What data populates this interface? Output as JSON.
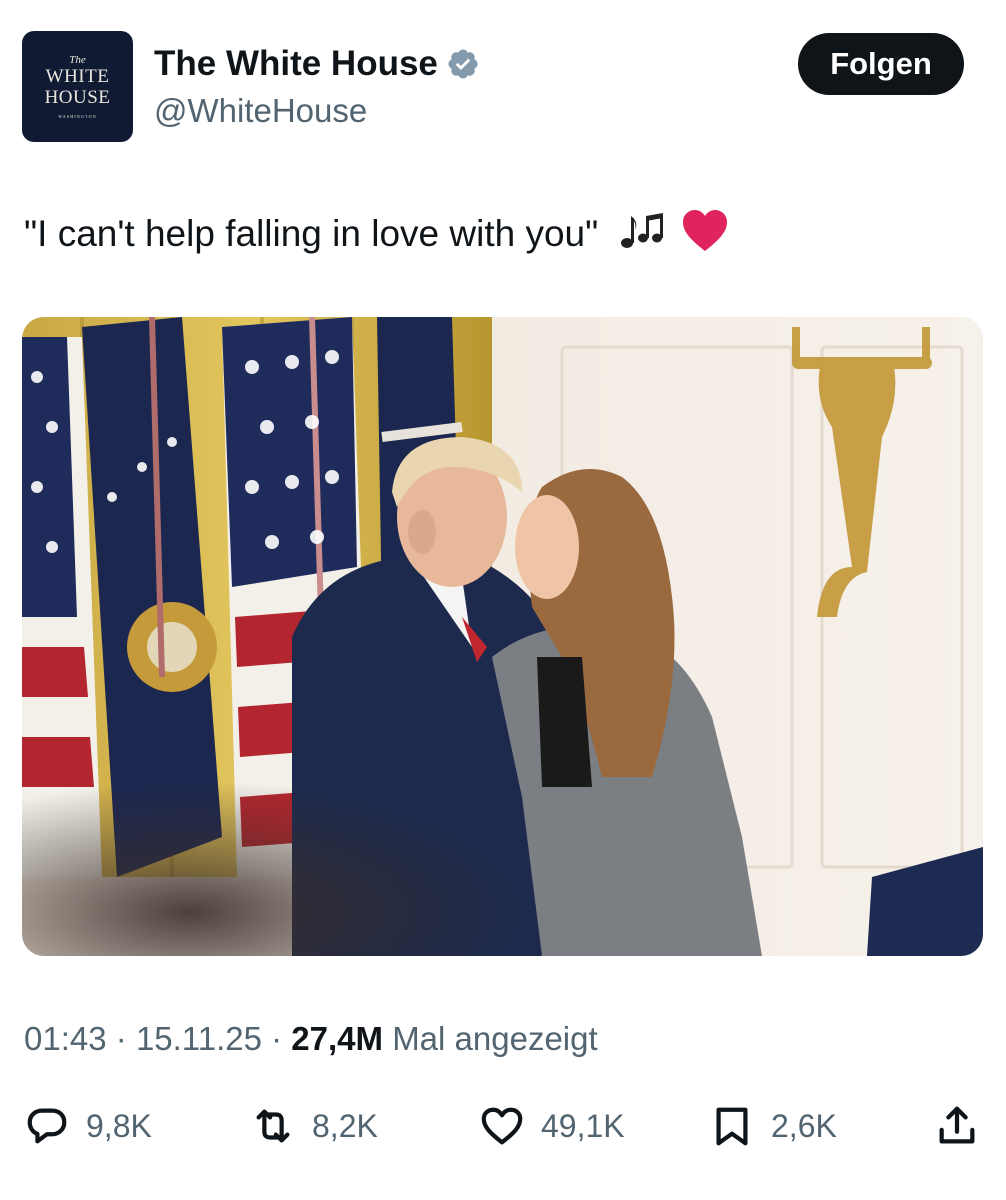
{
  "author": {
    "display_name": "The White House",
    "handle": "@WhiteHouse",
    "verified_icon": "verified-badge-icon",
    "avatar": {
      "line1": "The",
      "line2": "WHITE",
      "line3": "HOUSE",
      "line4": "WASHINGTON",
      "background": "#101b33"
    }
  },
  "follow_button": {
    "label": "Folgen"
  },
  "tweet": {
    "text": "\"I can't help falling in love with you\"",
    "emojis": [
      "notes-icon",
      "red-heart-icon"
    ]
  },
  "meta": {
    "time": "01:43",
    "sep1": "·",
    "date": "15.11.25",
    "sep2": "·",
    "views": "27,4M",
    "views_label": "Mal angezeigt"
  },
  "actions": {
    "replies": {
      "icon": "reply-icon",
      "count": "9,8K"
    },
    "reposts": {
      "icon": "repost-icon",
      "count": "8,2K"
    },
    "likes": {
      "icon": "heart-icon",
      "count": "49,1K"
    },
    "bookmarks": {
      "icon": "bookmark-icon",
      "count": "2,6K"
    },
    "share": {
      "icon": "share-icon"
    }
  },
  "colors": {
    "text": "#0f1419",
    "secondary": "#536471",
    "verified": "#829aab",
    "heart": "#e0245e"
  }
}
